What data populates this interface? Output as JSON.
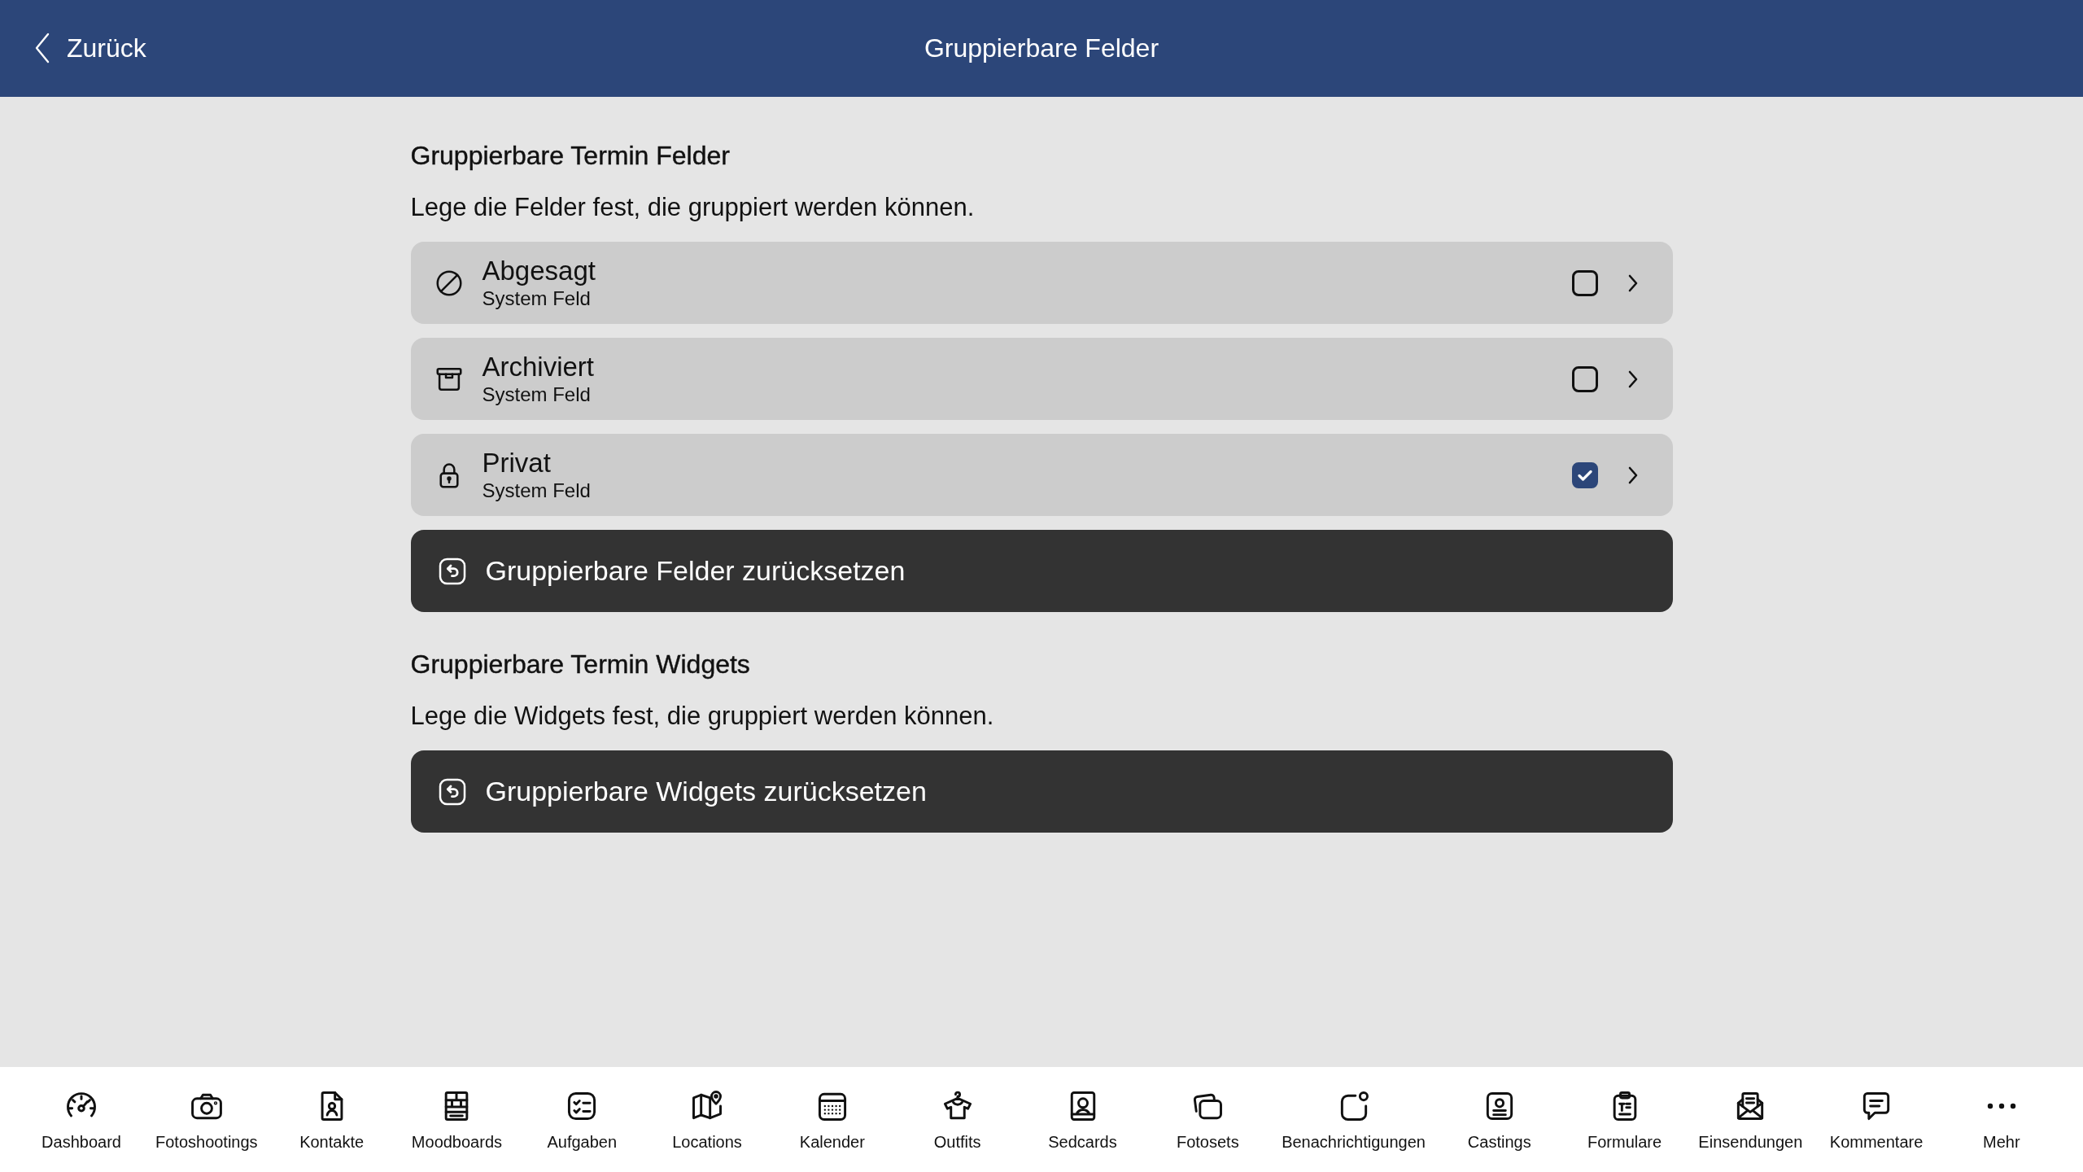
{
  "header": {
    "back_label": "Zurück",
    "title": "Gruppierbare Felder"
  },
  "sections": [
    {
      "title": "Gruppierbare Termin Felder",
      "description": "Lege die Felder fest, die gruppiert werden können.",
      "fields": [
        {
          "label": "Abgesagt",
          "sublabel": "System Feld",
          "checked": false
        },
        {
          "label": "Archiviert",
          "sublabel": "System Feld",
          "checked": false
        },
        {
          "label": "Privat",
          "sublabel": "System Feld",
          "checked": true
        }
      ],
      "reset_button": "Gruppierbare Felder zurücksetzen"
    },
    {
      "title": "Gruppierbare Termin Widgets",
      "description": "Lege die Widgets fest, die gruppiert werden können.",
      "reset_button": "Gruppierbare Widgets zurücksetzen"
    }
  ],
  "tab_bar": {
    "items": [
      {
        "label": "Dashboard"
      },
      {
        "label": "Fotoshootings"
      },
      {
        "label": "Kontakte"
      },
      {
        "label": "Moodboards"
      },
      {
        "label": "Aufgaben"
      },
      {
        "label": "Locations"
      },
      {
        "label": "Kalender"
      },
      {
        "label": "Outfits"
      },
      {
        "label": "Sedcards"
      },
      {
        "label": "Fotosets"
      },
      {
        "label": "Benachrichtigungen"
      },
      {
        "label": "Castings"
      },
      {
        "label": "Formulare"
      },
      {
        "label": "Einsendungen"
      },
      {
        "label": "Kommentare"
      },
      {
        "label": "Mehr"
      }
    ]
  }
}
